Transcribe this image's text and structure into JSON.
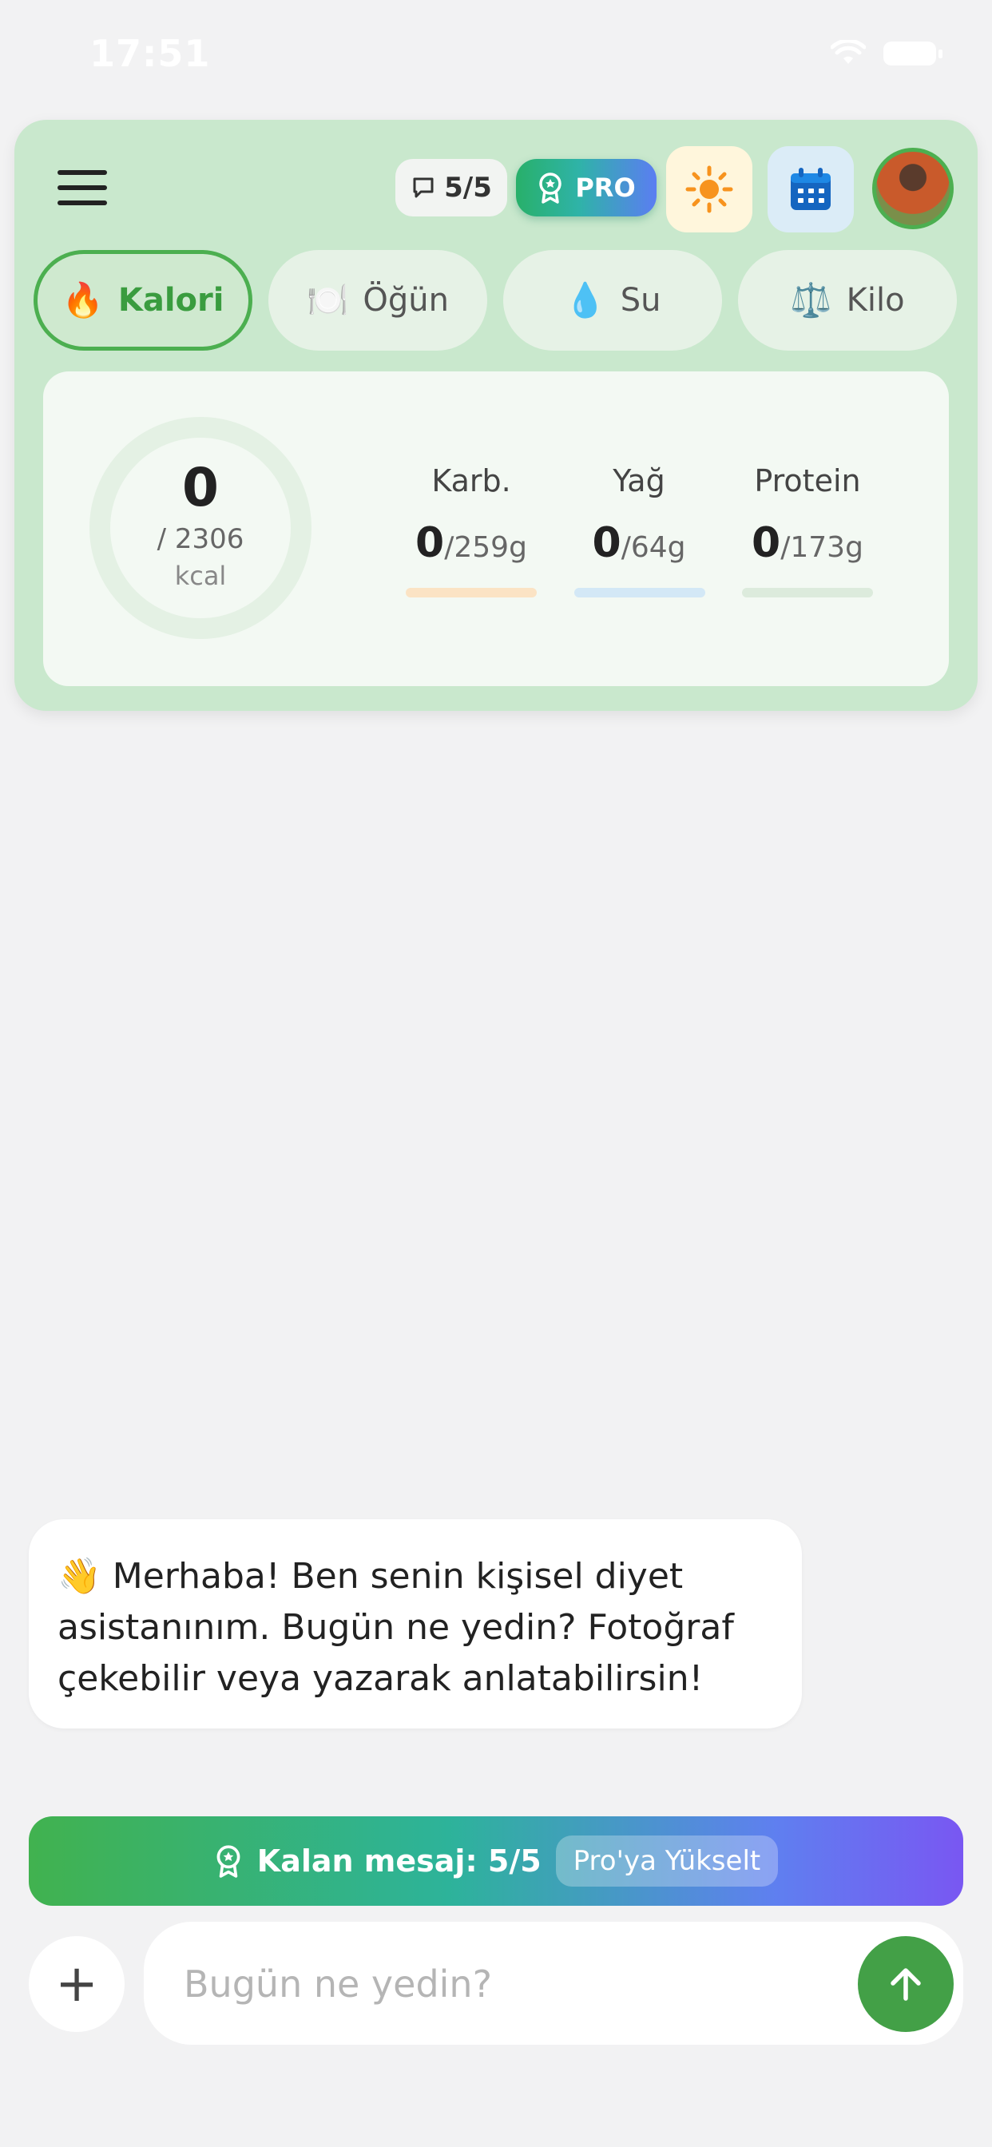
{
  "status_bar": {
    "time": "17:51"
  },
  "header": {
    "message_counter": "5/5",
    "pro_label": "PRO"
  },
  "tabs": [
    {
      "emoji": "🔥",
      "label": "Kalori",
      "active": true
    },
    {
      "emoji": "🍽️",
      "label": "Öğün",
      "active": false
    },
    {
      "emoji": "💧",
      "label": "Su",
      "active": false
    },
    {
      "emoji": "⚖️",
      "label": "Kilo",
      "active": false
    }
  ],
  "summary": {
    "calories_consumed": "0",
    "calories_goal": "/ 2306",
    "calories_unit": "kcal",
    "macros": [
      {
        "label": "Karb.",
        "value": "0",
        "goal": "/259g",
        "color": "#fbe3c4"
      },
      {
        "label": "Yağ",
        "value": "0",
        "goal": "/64g",
        "color": "#d3e8f6"
      },
      {
        "label": "Protein",
        "value": "0",
        "goal": "/173g",
        "color": "#dcebdc"
      }
    ]
  },
  "chat": {
    "greeting": "👋 Merhaba! Ben senin kişisel diyet asistanınım. Bugün ne yedin? Fotoğraf çekebilir veya yazarak anlatabilirsin!"
  },
  "banner": {
    "remaining_label": "Kalan mesaj: 5/5",
    "upgrade_label": "Pro'ya Yükselt"
  },
  "composer": {
    "plus_label": "+",
    "placeholder": "Bugün ne yedin?"
  },
  "colors": {
    "brand_green": "#4caf50",
    "header_bg": "#c9e8cd",
    "page_bg": "#f2f2f3"
  }
}
